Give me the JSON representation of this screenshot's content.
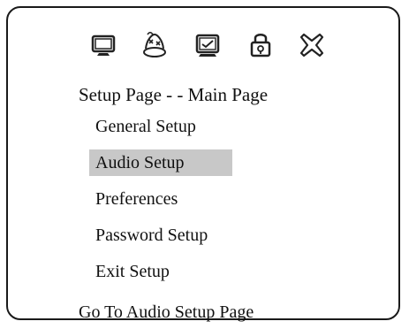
{
  "window": {
    "title": "Setup Page - - Main Page",
    "footer": "Go To Audio Setup Page"
  },
  "icon_bar": [
    {
      "icon": "monitor-icon",
      "name": "General Setup"
    },
    {
      "icon": "speaker-icon",
      "name": "Audio Setup"
    },
    {
      "icon": "preferences-icon",
      "name": "Preferences"
    },
    {
      "icon": "lock-icon",
      "name": "Password Setup"
    },
    {
      "icon": "exit-icon",
      "name": "Exit Setup"
    }
  ],
  "menu": {
    "selected_index": 1,
    "items": [
      {
        "label": "General Setup"
      },
      {
        "label": "Audio Setup"
      },
      {
        "label": "Preferences"
      },
      {
        "label": "Password Setup"
      },
      {
        "label": "Exit Setup"
      }
    ]
  },
  "colors": {
    "frame": "#1a1a1a",
    "selected_background": "#c8c8c8",
    "text": "#111111"
  }
}
